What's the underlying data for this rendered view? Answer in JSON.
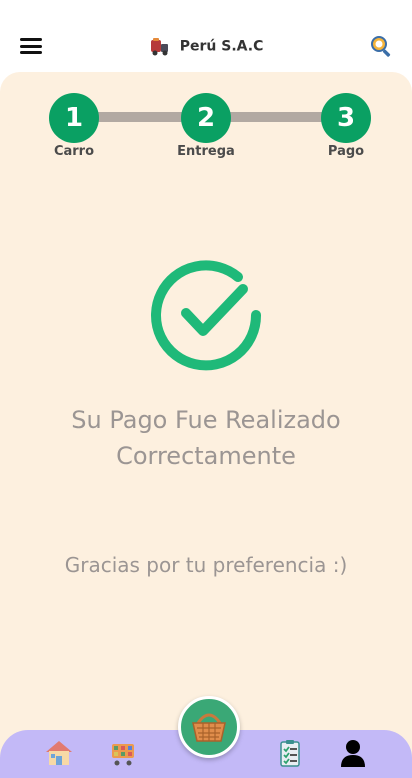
{
  "header": {
    "brand_name": "Perú S.A.C"
  },
  "stepper": {
    "steps": [
      {
        "number": "1",
        "label": "Carro"
      },
      {
        "number": "2",
        "label": "Entrega"
      },
      {
        "number": "3",
        "label": "Pago"
      }
    ],
    "accent_color": "#0aa063"
  },
  "confirmation": {
    "title_line1": "Su Pago Fue Realizado",
    "title_line2": "Correctamente",
    "thanks": "Gracias por tu preferencia :)"
  },
  "bottom_nav": {
    "items": [
      "home-icon",
      "store-cart-icon",
      "basket-icon",
      "order-list-icon",
      "user-icon"
    ],
    "background": "#c3b9f7"
  }
}
